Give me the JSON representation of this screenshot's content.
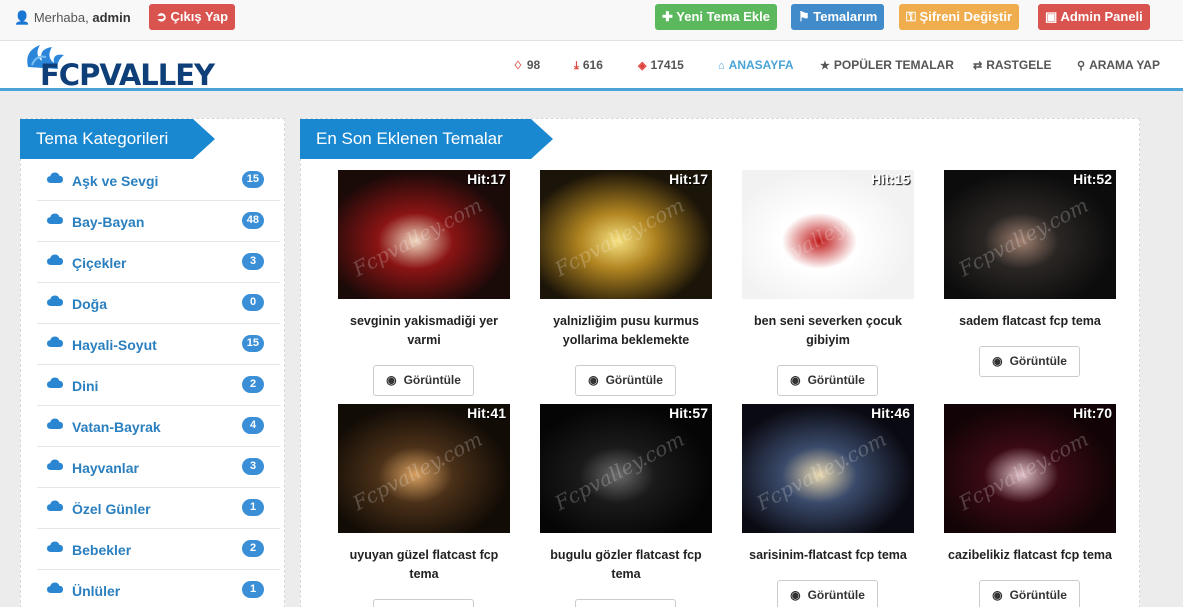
{
  "topbar": {
    "greeting": "Merhaba,",
    "username": "admin",
    "logout": "Çıkış Yap",
    "add_theme": "Yeni Tema Ekle",
    "my_themes": "Temalarım",
    "change_password": "Şifreni Değiştir",
    "admin_panel": "Admin Paneli"
  },
  "colors": {
    "red": "#d9534f",
    "green": "#5cb85c",
    "blue": "#428bca",
    "orange": "#f0ad4e",
    "accent": "#1a88d0"
  },
  "brand": {
    "logo_text": "FCPVALLEY"
  },
  "nav": {
    "stat_gems": "98",
    "stat_downloads": "616",
    "stat_views": "17415",
    "home": "ANASAYFA",
    "popular": "POPÜLER TEMALAR",
    "random": "RASTGELE",
    "search": "ARAMA YAP"
  },
  "sidebar": {
    "title": "Tema Kategorileri",
    "items": [
      {
        "label": "Aşk ve Sevgi",
        "count": "15"
      },
      {
        "label": "Bay-Bayan",
        "count": "48"
      },
      {
        "label": "Çiçekler",
        "count": "3"
      },
      {
        "label": "Doğa",
        "count": "0"
      },
      {
        "label": "Hayali-Soyut",
        "count": "15"
      },
      {
        "label": "Dini",
        "count": "2"
      },
      {
        "label": "Vatan-Bayrak",
        "count": "4"
      },
      {
        "label": "Hayvanlar",
        "count": "3"
      },
      {
        "label": "Özel Günler",
        "count": "1"
      },
      {
        "label": "Bebekler",
        "count": "2"
      },
      {
        "label": "Ünlüler",
        "count": "1"
      }
    ]
  },
  "main": {
    "title": "En Son Eklenen Temalar",
    "view_label": "Görüntüle",
    "watermark": "Fcpvalley.com",
    "themes": [
      {
        "hit": "Hit:17",
        "title_l1": "sevginin yakismadiği yer",
        "title_l2": "varmi"
      },
      {
        "hit": "Hit:17",
        "title_l1": "yalnizliğim pusu kurmus",
        "title_l2": "yollarima beklemekte"
      },
      {
        "hit": "Hit:15",
        "title_l1": "ben seni severken çocuk",
        "title_l2": "gibiyim"
      },
      {
        "hit": "Hit:52",
        "title_l1": "sadem flatcast fcp tema",
        "title_l2": ""
      },
      {
        "hit": "Hit:41",
        "title_l1": "uyuyan güzel flatcast fcp",
        "title_l2": "tema"
      },
      {
        "hit": "Hit:57",
        "title_l1": "bugulu gözler flatcast fcp",
        "title_l2": "tema"
      },
      {
        "hit": "Hit:46",
        "title_l1": "sarisinim-flatcast fcp tema",
        "title_l2": ""
      },
      {
        "hit": "Hit:70",
        "title_l1": "cazibelikiz flatcast fcp tema",
        "title_l2": ""
      }
    ]
  }
}
